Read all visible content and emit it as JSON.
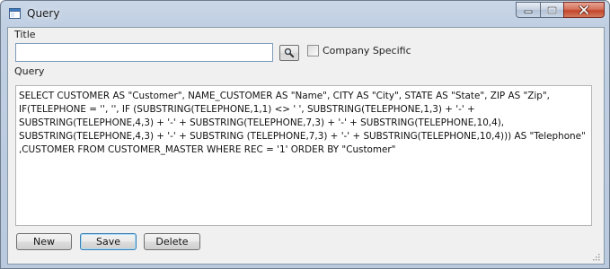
{
  "window": {
    "title": "Query"
  },
  "form": {
    "title_label": "Title",
    "title_value": "",
    "company_specific_label": "Company Specific",
    "company_specific_checked": false,
    "query_label": "Query",
    "query_text": "SELECT CUSTOMER AS \"Customer\", NAME_CUSTOMER AS \"Name\", CITY AS \"City\", STATE AS \"State\", ZIP AS \"Zip\", IF(TELEPHONE = '', '', IF (SUBSTRING(TELEPHONE,1,1) <> ' ', SUBSTRING(TELEPHONE,1,3) + '-' + SUBSTRING(TELEPHONE,4,3) + '-' + SUBSTRING(TELEPHONE,7,3) + '-' + SUBSTRING(TELEPHONE,10,4), SUBSTRING(TELEPHONE,4,3) + '-' + SUBSTRING (TELEPHONE,7,3) + '-' + SUBSTRING(TELEPHONE,10,4))) AS \"Telephone\" ,CUSTOMER FROM CUSTOMER_MASTER WHERE REC = '1' ORDER BY \"Customer\""
  },
  "buttons": {
    "new": "New",
    "save": "Save",
    "delete": "Delete"
  },
  "icons": {
    "app": "window-app-icon",
    "search": "search-icon",
    "minimize": "minimize-icon",
    "maximize": "maximize-icon",
    "close": "close-icon",
    "grip": "resize-grip-icon"
  }
}
